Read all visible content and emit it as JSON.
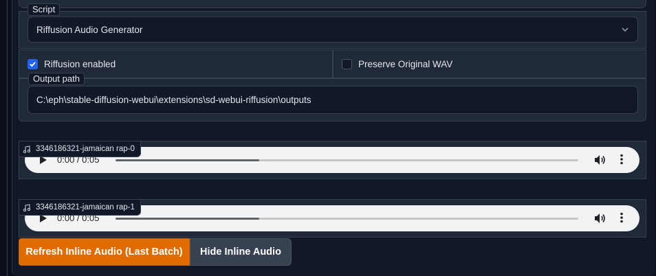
{
  "script_section": {
    "label": "Script",
    "selected_value": "Riffusion Audio Generator"
  },
  "options": {
    "riffusion_enabled": {
      "label": "Riffusion enabled",
      "checked": true
    },
    "preserve_wav": {
      "label": "Preserve Original WAV",
      "checked": false
    }
  },
  "output_path": {
    "label": "Output path",
    "value": "C:\\eph\\stable-diffusion-webui\\extensions\\sd-webui-riffusion\\outputs"
  },
  "audio_items": [
    {
      "label": "3346186321-jamaican rap-0",
      "time": "0:00 / 0:05",
      "progress": 0.31
    },
    {
      "label": "3346186321-jamaican rap-1",
      "time": "0:00 / 0:05",
      "progress": 0.31
    }
  ],
  "buttons": {
    "refresh": "Refresh Inline Audio (Last Batch)",
    "hide": "Hide Inline Audio"
  },
  "colors": {
    "accent": "#e06c00",
    "checkbox_checked": "#2563eb",
    "background": "#0b0f19",
    "panel": "#111827",
    "block": "#1f2937"
  },
  "icons": [
    "chevron-down-icon",
    "check-icon",
    "music-note-icon",
    "play-icon",
    "volume-icon",
    "more-vertical-icon"
  ]
}
